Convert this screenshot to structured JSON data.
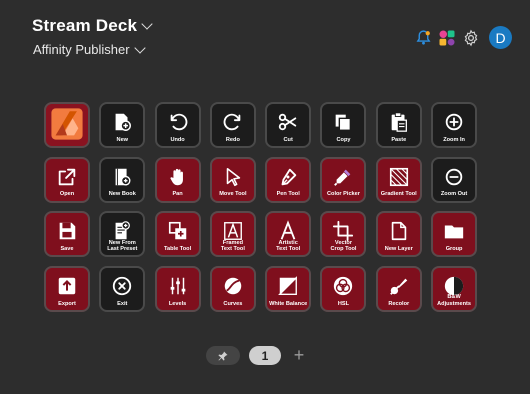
{
  "header": {
    "title": "Stream Deck",
    "profile": "Affinity Publisher",
    "avatar_letter": "D",
    "icons": [
      "bell-icon",
      "marketplace-icon",
      "gear-icon"
    ]
  },
  "keys": [
    {
      "label": "",
      "icon": "affinity-publisher-logo",
      "style": "logo"
    },
    {
      "label": "New",
      "icon": "new-document-icon",
      "style": "dark"
    },
    {
      "label": "Undo",
      "icon": "undo-icon",
      "style": "dark"
    },
    {
      "label": "Redo",
      "icon": "redo-icon",
      "style": "dark"
    },
    {
      "label": "Cut",
      "icon": "scissors-icon",
      "style": "dark"
    },
    {
      "label": "Copy",
      "icon": "copy-icon",
      "style": "dark"
    },
    {
      "label": "Paste",
      "icon": "paste-icon",
      "style": "dark"
    },
    {
      "label": "Zoom In",
      "icon": "zoom-in-icon",
      "style": "dark"
    },
    {
      "label": "Open",
      "icon": "open-icon",
      "style": "red"
    },
    {
      "label": "New Book",
      "icon": "new-book-icon",
      "style": "dark"
    },
    {
      "label": "Pan",
      "icon": "hand-icon",
      "style": "red"
    },
    {
      "label": "Move Tool",
      "icon": "cursor-icon",
      "style": "red"
    },
    {
      "label": "Pen Tool",
      "icon": "pen-nib-icon",
      "style": "red"
    },
    {
      "label": "Color Picker",
      "icon": "eyedropper-icon",
      "style": "red"
    },
    {
      "label": "Gradient Tool",
      "icon": "gradient-icon",
      "style": "red"
    },
    {
      "label": "Zoom Out",
      "icon": "zoom-out-icon",
      "style": "dark"
    },
    {
      "label": "Save",
      "icon": "floppy-icon",
      "style": "red"
    },
    {
      "label": "New From\nLast Preset",
      "icon": "new-preset-icon",
      "style": "dark"
    },
    {
      "label": "Table Tool",
      "icon": "table-icon",
      "style": "red"
    },
    {
      "label": "Framed\nText Tool",
      "icon": "framed-text-icon",
      "style": "red"
    },
    {
      "label": "Artistic\nText Tool",
      "icon": "artistic-text-icon",
      "style": "red"
    },
    {
      "label": "Vector\nCrop Tool",
      "icon": "crop-icon",
      "style": "red"
    },
    {
      "label": "New Layer",
      "icon": "layer-icon",
      "style": "red"
    },
    {
      "label": "Group",
      "icon": "folder-icon",
      "style": "red"
    },
    {
      "label": "Export",
      "icon": "export-icon",
      "style": "red"
    },
    {
      "label": "Exit",
      "icon": "exit-icon",
      "style": "dark"
    },
    {
      "label": "Levels",
      "icon": "levels-icon",
      "style": "red"
    },
    {
      "label": "Curves",
      "icon": "curves-icon",
      "style": "red"
    },
    {
      "label": "White Balance",
      "icon": "white-balance-icon",
      "style": "red"
    },
    {
      "label": "HSL",
      "icon": "hsl-icon",
      "style": "red"
    },
    {
      "label": "Recolor",
      "icon": "recolor-icon",
      "style": "red"
    },
    {
      "label": "B&W\nAdjustments",
      "icon": "bw-icon",
      "style": "red"
    }
  ],
  "footer": {
    "page_number": "1",
    "add_page": "+",
    "pin_icon": "pin-icon"
  }
}
